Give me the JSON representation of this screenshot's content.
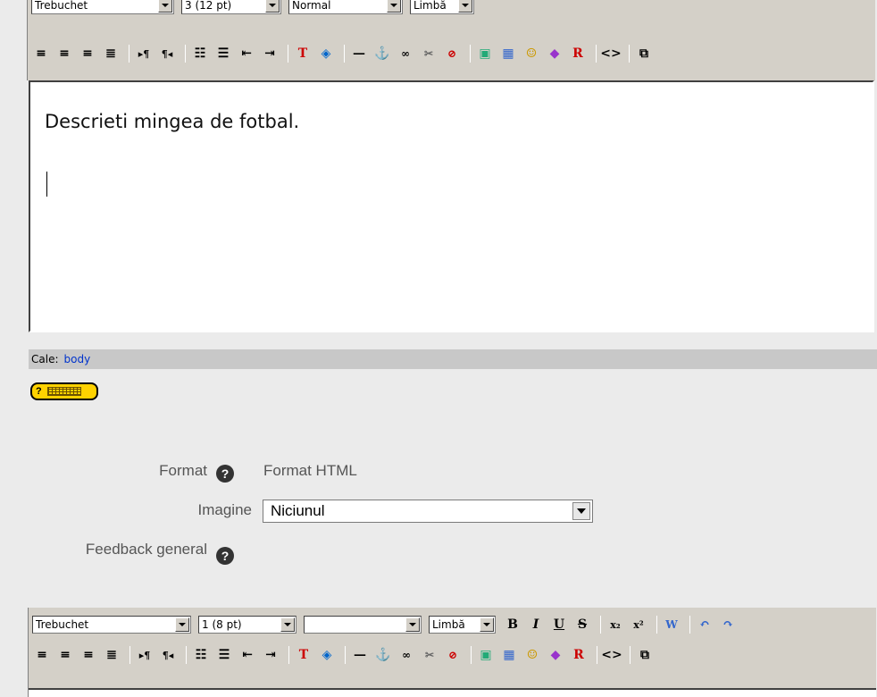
{
  "toolbar_top": {
    "font": "Trebuchet",
    "size": "3 (12 pt)",
    "style": "Normal",
    "lang": "Limbă"
  },
  "editor": {
    "text": "Descrieti mingea de fotbal."
  },
  "pathbar": {
    "label": "Cale:",
    "value": "body"
  },
  "form": {
    "format_label": "Format",
    "format_value": "Format HTML",
    "imagine_label": "Imagine",
    "imagine_value": "Niciunul",
    "feedback_label": "Feedback general"
  },
  "toolbar_bottom": {
    "font": "Trebuchet",
    "size": "1 (8 pt)",
    "style": "",
    "lang": "Limbă",
    "bold": "B",
    "italic": "I",
    "underline": "U",
    "strike": "S"
  },
  "help_icon_text": "?",
  "accent": {
    "link": "#0033cc",
    "kbd": "#ffd200"
  }
}
